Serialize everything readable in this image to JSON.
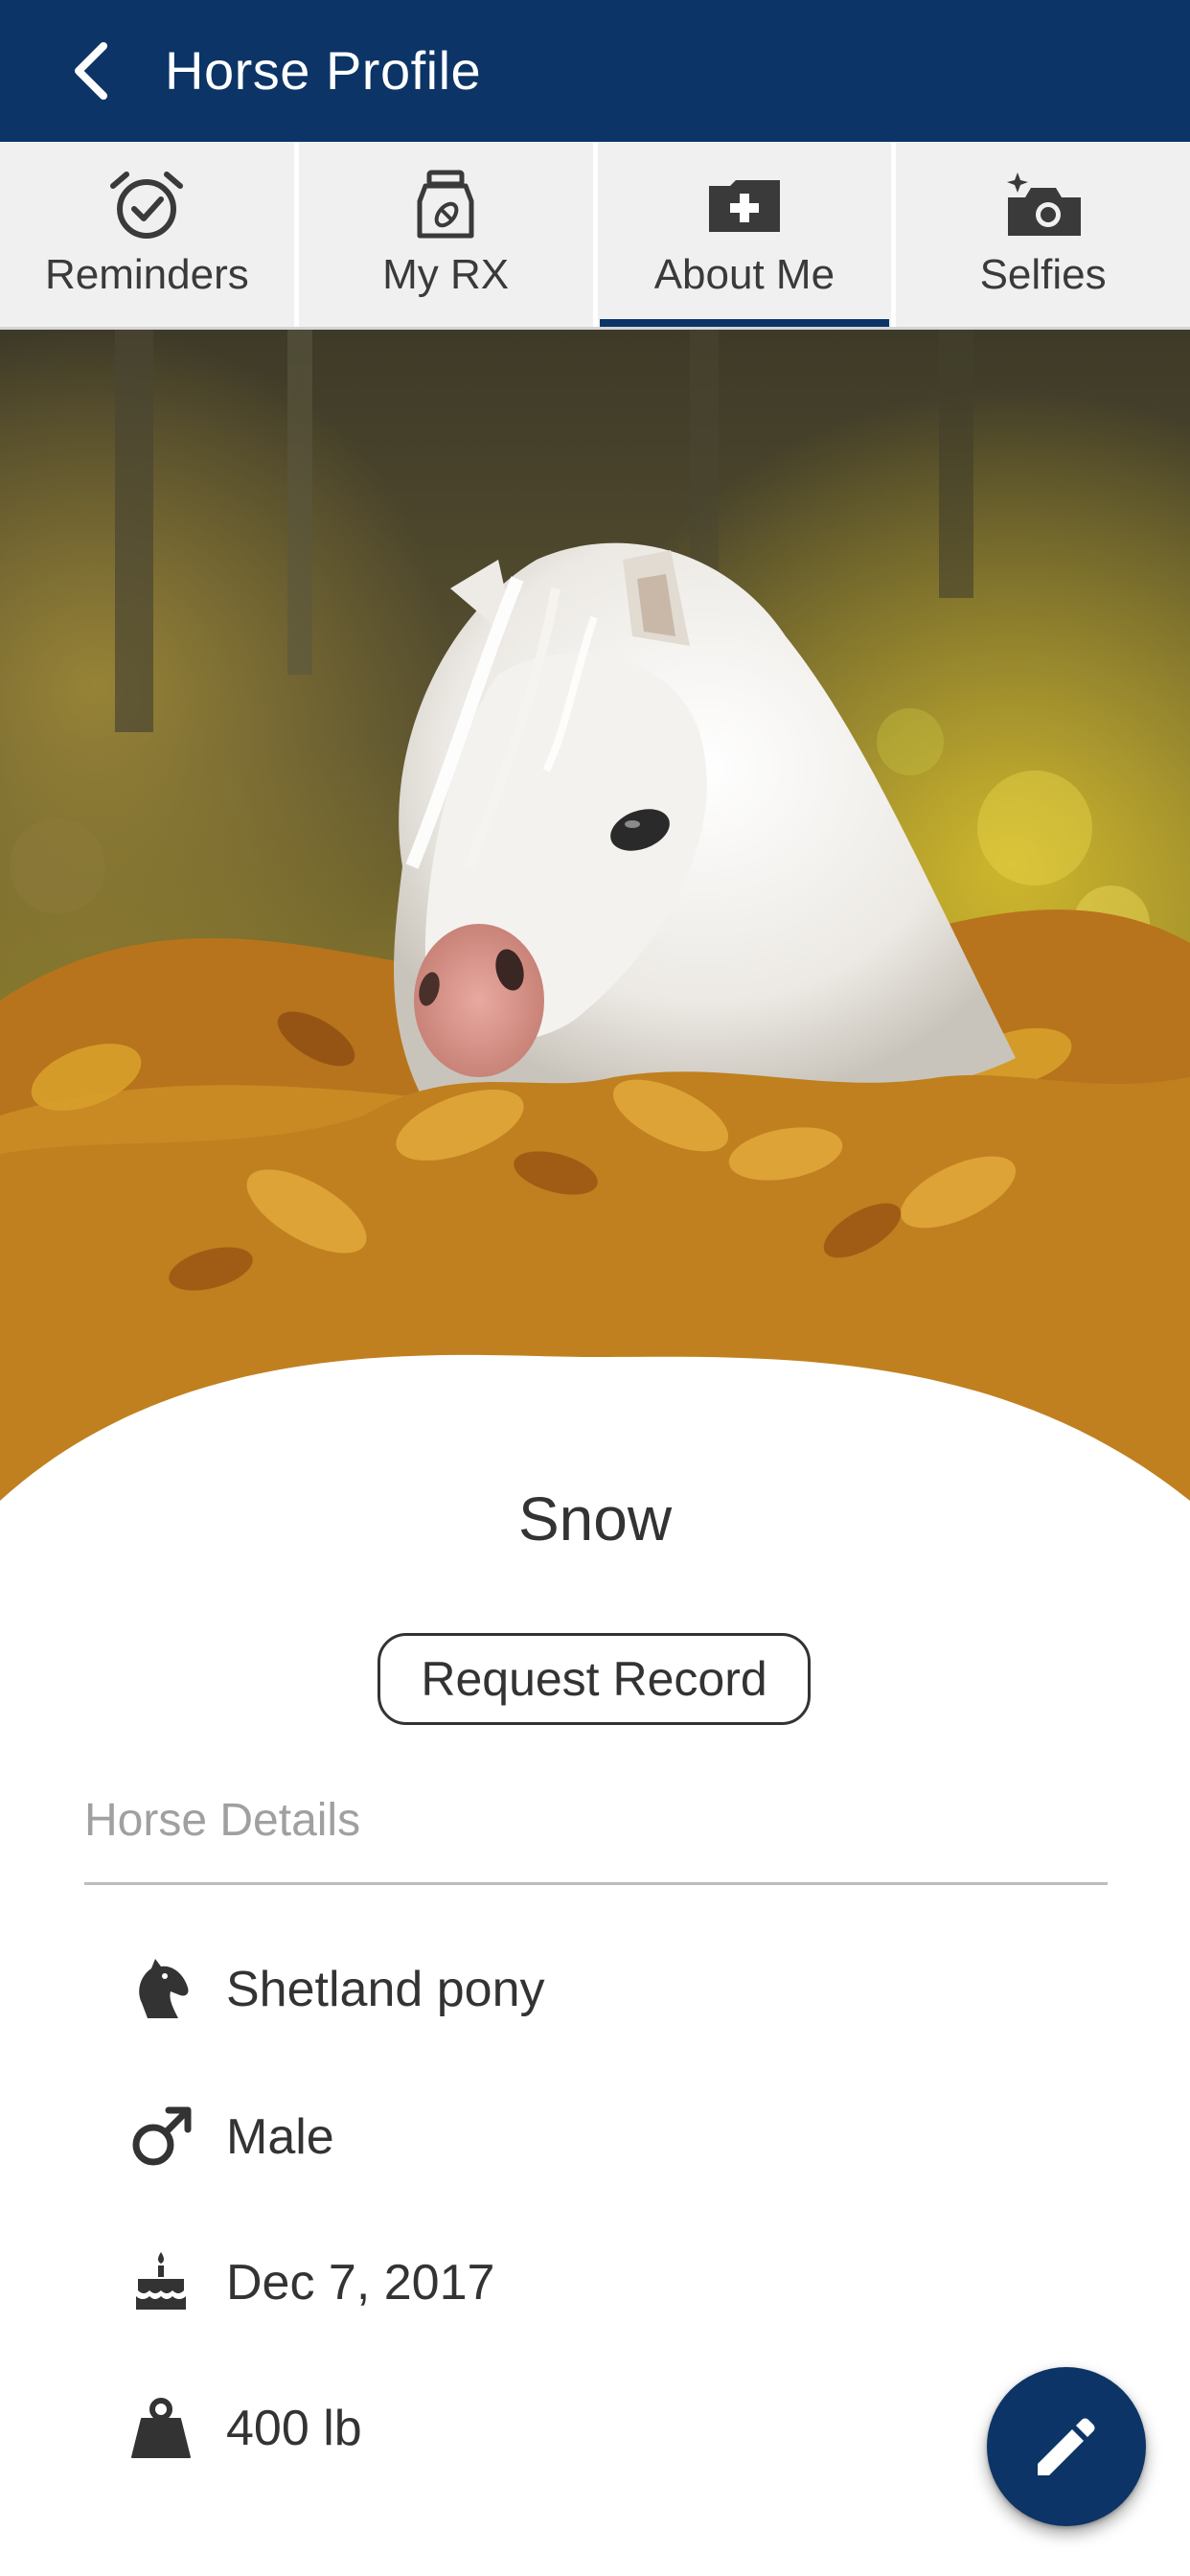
{
  "app_bar": {
    "title": "Horse Profile",
    "back_icon": "chevron-left-icon",
    "background_color": "#0c3466"
  },
  "tabs": [
    {
      "label": "Reminders",
      "icon": "alarm-check-icon",
      "active": false
    },
    {
      "label": "My RX",
      "icon": "medicine-bottle-icon",
      "active": false
    },
    {
      "label": "About Me",
      "icon": "medical-folder-icon",
      "active": true
    },
    {
      "label": "Selfies",
      "icon": "camera-sparkle-icon",
      "active": false
    }
  ],
  "hero": {
    "icon": "horse-photo"
  },
  "profile": {
    "name": "Snow",
    "request_record_label": "Request Record"
  },
  "details": {
    "header": "Horse Details",
    "items": [
      {
        "icon": "horse-head-icon",
        "value": "Shetland pony"
      },
      {
        "icon": "male-symbol-icon",
        "value": "Male"
      },
      {
        "icon": "birthday-cake-icon",
        "value": "Dec 7, 2017"
      },
      {
        "icon": "weight-icon",
        "value": "400 lb"
      }
    ]
  },
  "fab": {
    "icon": "pencil-edit-icon"
  }
}
